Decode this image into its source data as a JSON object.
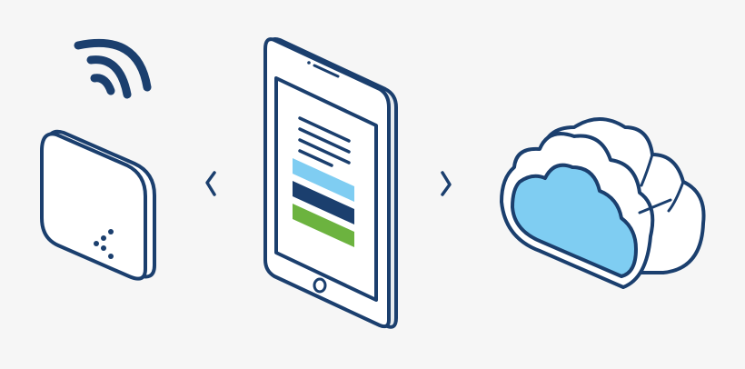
{
  "colors": {
    "background": "#f6f6f6",
    "outline": "#1b3f6e",
    "light_blue": "#7fcdf2",
    "navy": "#1b3f6e",
    "green": "#6cb33f",
    "white": "#ffffff"
  },
  "icons": {
    "wifi": "wifi-icon",
    "sensor": "sensor-device-icon",
    "tablet": "tablet-icon",
    "cloud": "cloud-icon",
    "left_arrow": "chevron-left-icon",
    "right_arrow": "chevron-right-icon"
  }
}
